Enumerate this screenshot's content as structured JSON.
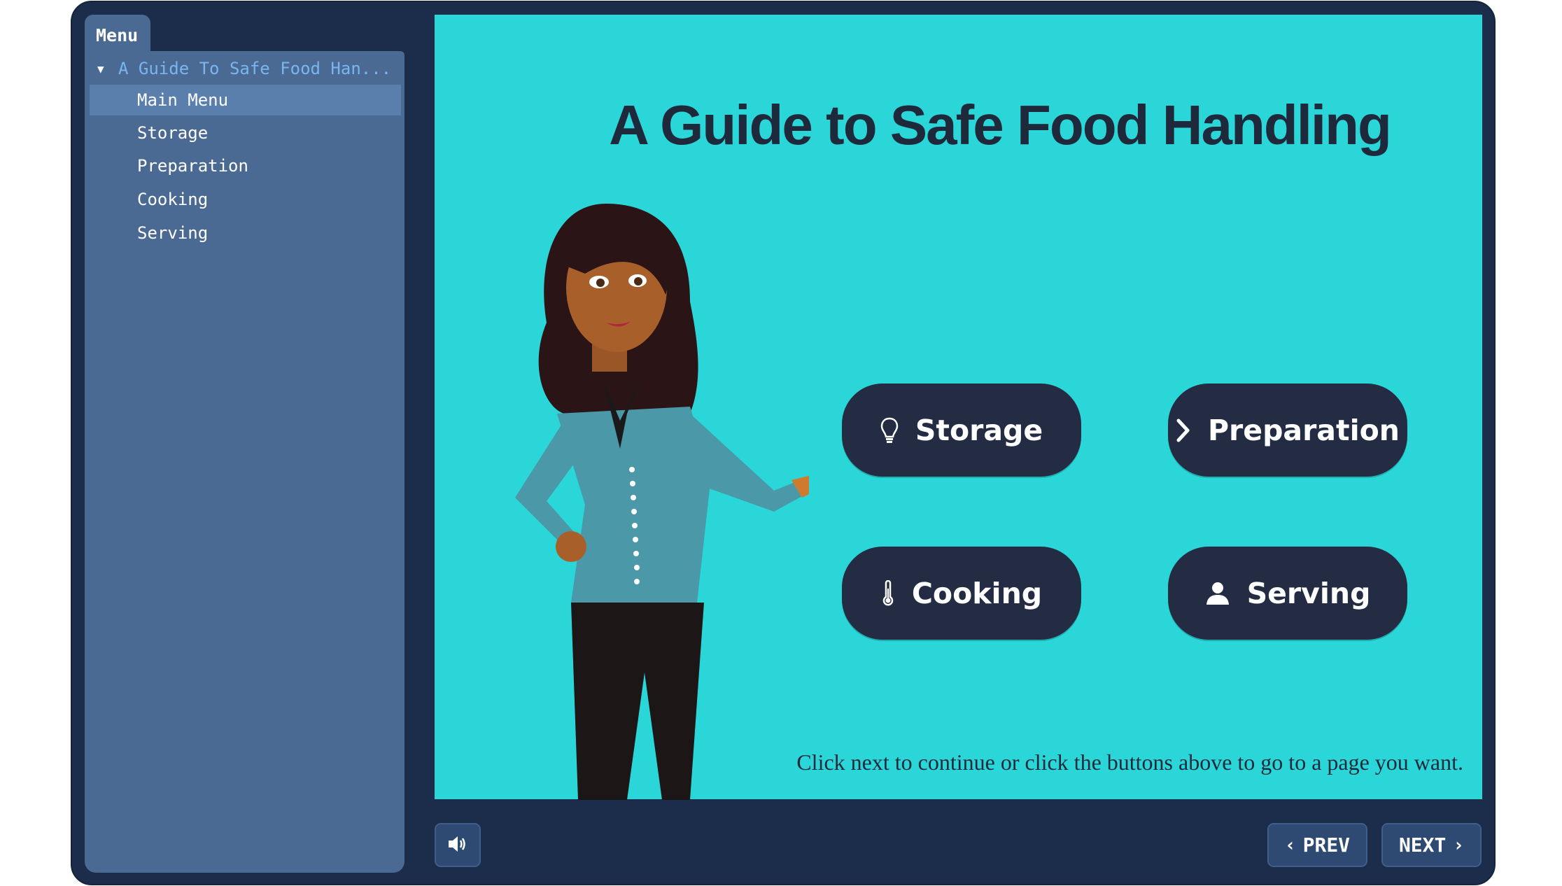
{
  "sidebar": {
    "tab_label": "Menu",
    "course_title": "A Guide To Safe Food Han...",
    "items": [
      {
        "label": "Main Menu",
        "active": true
      },
      {
        "label": "Storage"
      },
      {
        "label": "Preparation"
      },
      {
        "label": "Cooking"
      },
      {
        "label": "Serving"
      }
    ]
  },
  "slide": {
    "title": "A Guide to Safe Food Handling",
    "buttons": {
      "storage": {
        "label": "Storage",
        "icon": "lightbulb-icon"
      },
      "preparation": {
        "label": "Preparation",
        "icon": "chevron-right-icon"
      },
      "cooking": {
        "label": "Cooking",
        "icon": "thermometer-icon"
      },
      "serving": {
        "label": "Serving",
        "icon": "person-icon"
      }
    },
    "caption": "Click next to continue or click the buttons above to go to a page you want."
  },
  "footer": {
    "volume_icon": "speaker-icon",
    "prev_label": "PREV",
    "next_label": "NEXT"
  },
  "colors": {
    "player_bg": "#1b2d4a",
    "sidebar_bg": "#4a6a93",
    "slide_bg": "#2bd6d8",
    "button_bg": "#232c43",
    "active_item": "#5a7fad"
  }
}
